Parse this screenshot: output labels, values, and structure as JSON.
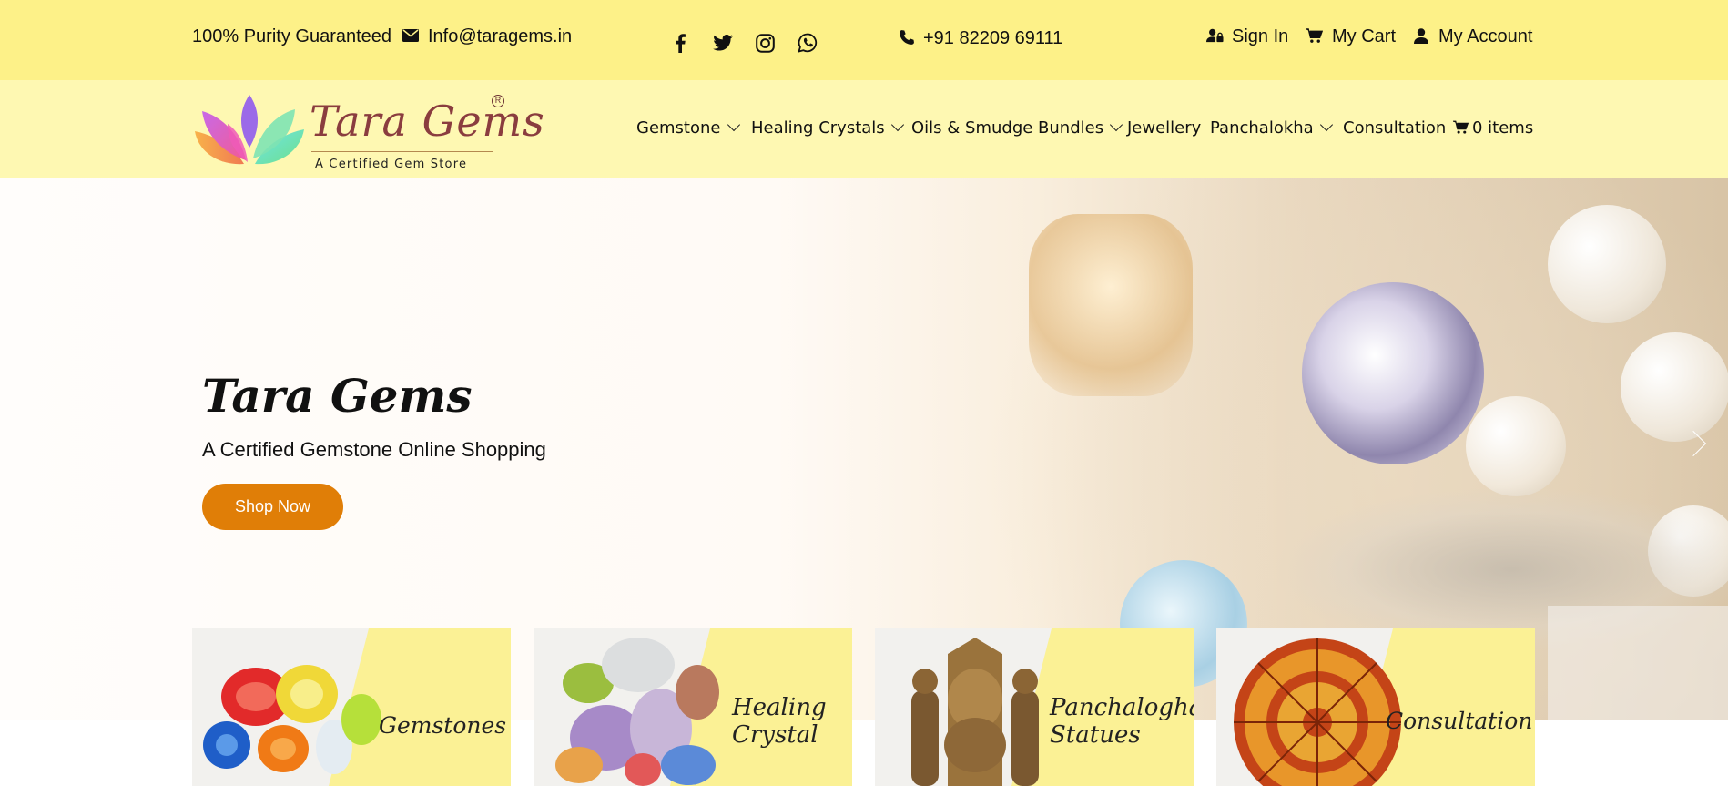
{
  "topbar": {
    "purity": "100% Purity Guaranteed",
    "email": "Info@taragems.in",
    "phone": "+91 82209 69111",
    "sign_in": "Sign In",
    "my_cart": "My Cart",
    "my_account": "My Account"
  },
  "logo": {
    "title": "Tara Gems",
    "registered": "R",
    "tagline": "A Certified Gem Store"
  },
  "nav": {
    "items": [
      {
        "label": "Gemstone"
      },
      {
        "label": "Healing Crystals"
      },
      {
        "label": "Oils & Smudge Bundles"
      },
      {
        "label": "Jewellery"
      },
      {
        "label": "Panchalokha"
      },
      {
        "label": "Consultation"
      }
    ],
    "cart_label": "0 items"
  },
  "hero": {
    "title": "Tara Gems",
    "subtitle": "A Certified Gemstone Online Shopping",
    "button": "Shop Now"
  },
  "cards": [
    {
      "line1": "Gemstones",
      "line2": ""
    },
    {
      "line1": "Healing",
      "line2": "Crystal"
    },
    {
      "line1": "Panchalogha",
      "line2": "Statues"
    },
    {
      "line1": "Consultation",
      "line2": ""
    }
  ],
  "colors": {
    "topbar_bg": "#fdf188",
    "navbar_bg": "#fef8b2",
    "accent": "#e07e07",
    "logo_text": "#8a3d3f"
  }
}
